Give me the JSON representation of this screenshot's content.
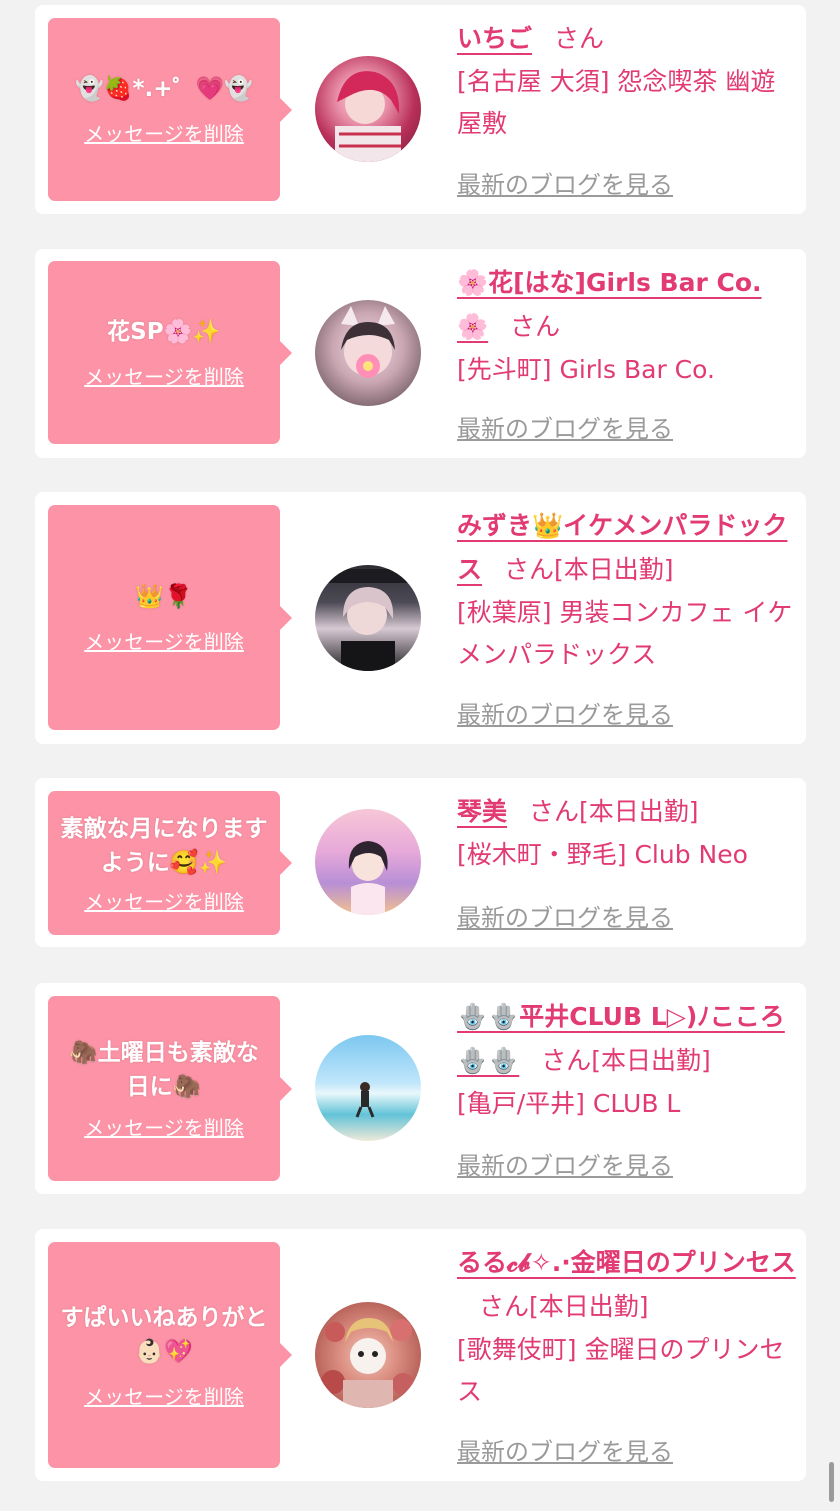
{
  "colors": {
    "bubble": "#fc93a6",
    "accent": "#e23a72",
    "blog_link": "#9a9a9a",
    "background": "#f2f2f2"
  },
  "delete_label": "メッセージを削除",
  "blog_label": "最新のブログを見る",
  "san": "さん",
  "cards": [
    {
      "message": "👻🍓*.+゜💗👻",
      "name": "いちご",
      "status": "",
      "shop": "[名古屋 大須] 怨念喫茶 幽遊屋敷",
      "avatar": "avatar-girl-pink-hair"
    },
    {
      "message": "花SP🌸✨",
      "name": "🌸花[はな]Girls Bar Co. 🌸",
      "status": "",
      "shop": "[先斗町] Girls Bar Co.",
      "avatar": "avatar-girl-cat-ears"
    },
    {
      "message": "👑🌹",
      "name": "みずき👑イケメンパラドックス",
      "status": "[本日出勤]",
      "shop": "[秋葉原] 男装コンカフェ イケメンパラドックス",
      "avatar": "avatar-ikemen-paradox"
    },
    {
      "message": "素敵な月になりますように🥰✨",
      "name": "琴美",
      "status": "[本日出勤]",
      "shop": "[桜木町・野毛] Club Neo",
      "avatar": "avatar-girl-sunset"
    },
    {
      "message": "🦣土曜日も素敵な日に🦣",
      "name": "🪬🪬平井CLUB L▷)ﾉこころ🪬🪬",
      "status": "[本日出勤]",
      "shop": "[亀戸/平井] CLUB L",
      "avatar": "avatar-beach"
    },
    {
      "message": "すぱいいねありがと👶🏻💖",
      "name": "るる𝓬𝓫✧.·金曜日のプリンセス",
      "status": "[本日出勤]",
      "shop": "[歌舞伎町] 金曜日のプリンセス",
      "avatar": "avatar-girl-flowers"
    }
  ]
}
